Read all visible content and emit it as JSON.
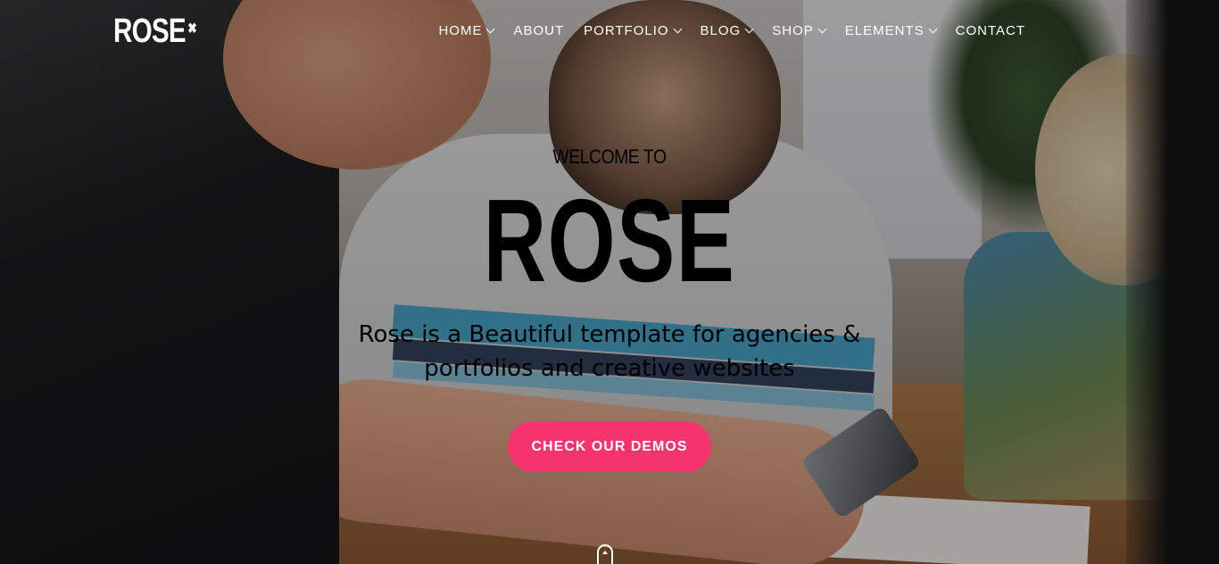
{
  "header": {
    "logo_text": "ROSE",
    "logo_mark": "✖",
    "nav": [
      {
        "label": "HOME",
        "has_dropdown": true
      },
      {
        "label": "ABOUT",
        "has_dropdown": false
      },
      {
        "label": "PORTFOLIO",
        "has_dropdown": true
      },
      {
        "label": "BLOG",
        "has_dropdown": true
      },
      {
        "label": "SHOP",
        "has_dropdown": true
      },
      {
        "label": "ELEMENTS",
        "has_dropdown": true
      },
      {
        "label": "CONTACT",
        "has_dropdown": false
      }
    ]
  },
  "hero": {
    "welcome": "WELCOME TO",
    "title": "ROSE",
    "subtitle_line1": "Rose is a Beautiful template for agencies &",
    "subtitle_line2": "portfolios and creative websites",
    "cta_label": "CHECK OUR DEMOS",
    "scroll_icon": "mouse-scroll-icon"
  },
  "colors": {
    "accent": "#f5336f",
    "text": "#ffffff"
  }
}
